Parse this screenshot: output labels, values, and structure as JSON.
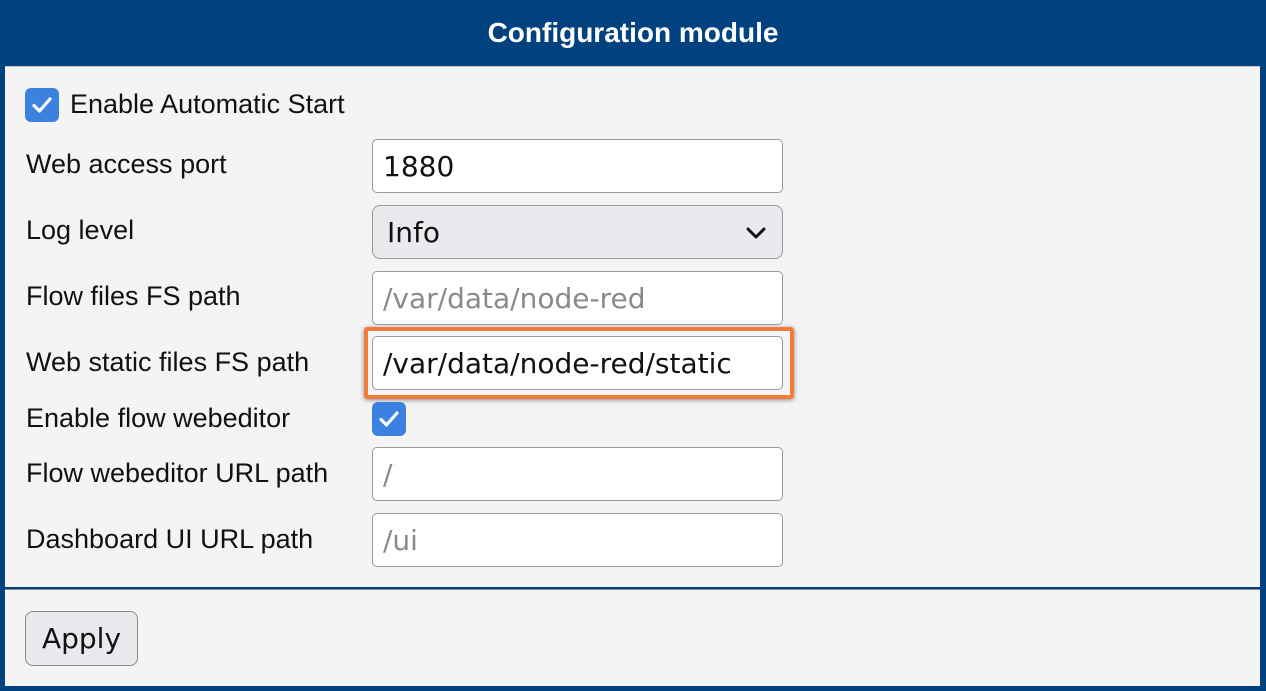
{
  "window": {
    "title": "Configuration module"
  },
  "form": {
    "auto_start": {
      "label": "Enable Automatic Start",
      "checked": true
    },
    "web_port": {
      "label": "Web access port",
      "value": "1880"
    },
    "log_level": {
      "label": "Log level",
      "selected": "Info"
    },
    "flow_files_path": {
      "label": "Flow files FS path",
      "value": "",
      "placeholder": "/var/data/node-red"
    },
    "static_files_path": {
      "label": "Web static files FS path",
      "value": "/var/data/node-red/static"
    },
    "flow_webeditor": {
      "label": "Enable flow webeditor",
      "checked": true
    },
    "webeditor_url": {
      "label": "Flow webeditor URL path",
      "value": "",
      "placeholder": "/"
    },
    "dashboard_url": {
      "label": "Dashboard UI URL path",
      "value": "",
      "placeholder": "/ui"
    }
  },
  "footer": {
    "apply_label": "Apply"
  },
  "colors": {
    "title_bar": "#004280",
    "checkbox": "#3b82e0",
    "highlight": "#f47b3b",
    "panel": "#f4f4f4"
  },
  "icons": {
    "checkbox_mark": "check-icon",
    "dropdown": "chevron-down-icon"
  }
}
